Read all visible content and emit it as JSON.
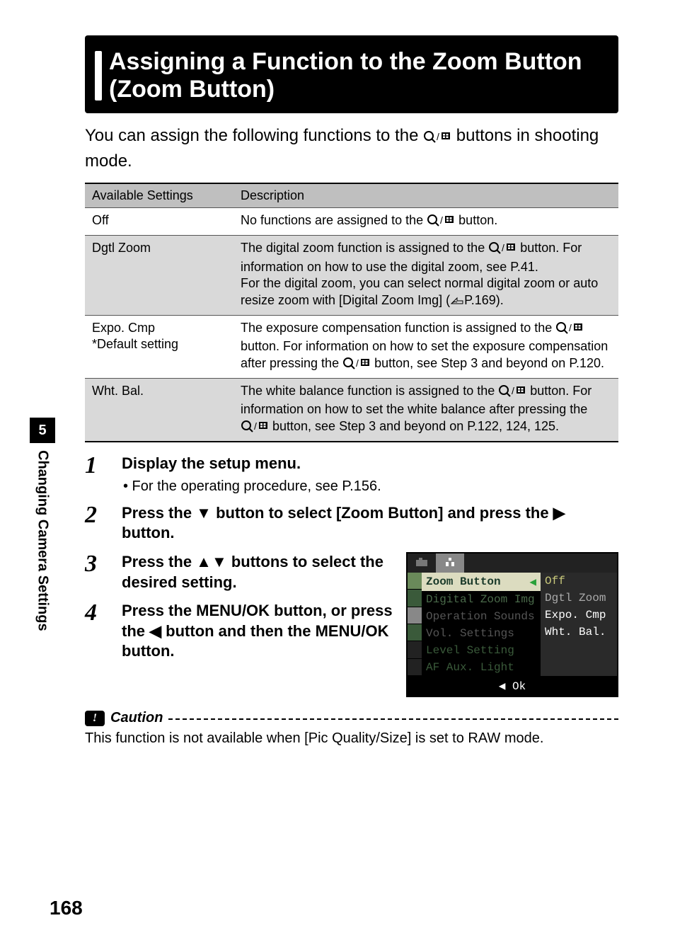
{
  "title": "Assigning a Function to the Zoom Button (Zoom Button)",
  "intro_a": "You can assign the following functions to the ",
  "intro_b": " buttons in shooting mode.",
  "table": {
    "headers": {
      "c1": "Available Settings",
      "c2": "Description"
    },
    "rows": [
      {
        "name": "Off",
        "desc_a": "No functions are assigned to the ",
        "desc_b": " button."
      },
      {
        "name": "Dgtl Zoom",
        "desc_a": "The digital zoom function is assigned to the ",
        "desc_b": " button. For information on how to use the digital zoom, see P.41.",
        "desc_c": "For the digital zoom, you can select normal digital zoom or auto resize zoom with [Digital Zoom Img] (",
        "desc_d": "P.169)."
      },
      {
        "name_a": "Expo. Cmp",
        "name_b": "*Default setting",
        "desc_a": "The exposure compensation function is assigned to the ",
        "desc_b": " button. For information on how to set the exposure compensation after pressing the ",
        "desc_c": " button, see Step 3 and beyond on P.120."
      },
      {
        "name": "Wht. Bal.",
        "desc_a": "The white balance function is assigned to the ",
        "desc_b": " button. For information on how to set the white balance after pressing the ",
        "desc_c": " button, see Step 3 and beyond on P.122, 124, 125."
      }
    ]
  },
  "steps": {
    "s1": {
      "num": "1",
      "head": "Display the setup menu.",
      "bullet": "• For the operating procedure, see P.156."
    },
    "s2": {
      "num": "2",
      "head_a": "Press the ",
      "head_b": " button to select [Zoom Button] and press the ",
      "head_c": " button."
    },
    "s3": {
      "num": "3",
      "head_a": "Press the ",
      "head_b": " buttons to select the desired setting."
    },
    "s4": {
      "num": "4",
      "head_a": "Press the MENU/OK button, or press the ",
      "head_b": " button and then the MENU/OK button."
    }
  },
  "lcd": {
    "items": [
      "Zoom Button",
      "Digital Zoom Img",
      "Operation Sounds",
      "Vol. Settings",
      "Level Setting",
      "AF Aux. Light"
    ],
    "options": [
      "Off",
      "Dgtl Zoom",
      "Expo. Cmp",
      "Wht. Bal."
    ],
    "footer": "Ok"
  },
  "caution": {
    "label": "Caution",
    "body": "This function is not available when [Pic Quality/Size] is set to RAW mode."
  },
  "side": {
    "num": "5",
    "label": "Changing Camera Settings"
  },
  "page_number": "168"
}
